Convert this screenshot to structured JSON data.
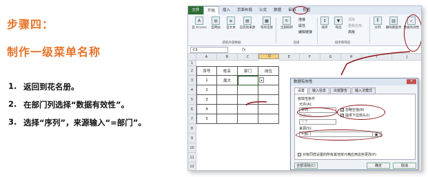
{
  "heading": {
    "line1": "步骤四：",
    "line2": "制作一级菜单名称"
  },
  "steps": [
    {
      "num": "1.",
      "text": "返回到花名册。"
    },
    {
      "num": "2.",
      "text": "在部门列选择“数据有效性”。"
    },
    {
      "num": "3.",
      "text": "选择“序列”，来源输入“=部门”。"
    }
  ],
  "excel": {
    "tabs": [
      "文件",
      "开始",
      "插入",
      "页面布局",
      "公式",
      "数据",
      "审阅",
      "视图"
    ],
    "ribbon": {
      "g1": [
        "自 Access",
        "自网站",
        "自文本",
        "自其他来源",
        "现有连接"
      ],
      "g1_label": "获取外部数据",
      "g2": [
        "全部刷新"
      ],
      "g2_small": [
        "连接",
        "属性",
        "编辑链接"
      ],
      "g2_label": "连接",
      "g3": [
        "排序",
        "筛选"
      ],
      "g3_small": [
        "清除",
        "重新应用",
        "高级"
      ],
      "g3_label": "排序和筛选",
      "g4": [
        "分列",
        "删除重复项",
        "数据有效性"
      ]
    },
    "namebox": "C3",
    "fx": "fx",
    "columns": [
      "A",
      "B",
      "C",
      "D",
      "E",
      "F",
      "G",
      "H",
      "I",
      "J"
    ],
    "rows": [
      "1",
      "2",
      "3",
      "4",
      "5",
      "6",
      "7",
      "8",
      "9",
      "10",
      "11",
      "12"
    ],
    "table": {
      "headers": [
        "序号",
        "姓名",
        "部门",
        "岗位"
      ],
      "data": [
        [
          "1",
          "周大",
          "",
          ""
        ],
        [
          "2",
          "",
          "",
          ""
        ],
        [
          "3",
          "",
          "",
          ""
        ],
        [
          "4",
          "",
          "",
          ""
        ],
        [
          "5",
          "",
          "",
          ""
        ]
      ]
    },
    "dialog": {
      "title": "数据有效性",
      "close": "✕",
      "tabs": [
        "设置",
        "输入信息",
        "出错警告",
        "输入法模式"
      ],
      "criteria": "有效性条件",
      "allow_label": "允许(A):",
      "allow_value": "序列",
      "ignore_blank": "忽略空值(B)",
      "dropdown": "提供下拉箭头(I)",
      "data_label": "数据(D):",
      "data_value": "介于",
      "source_label": "来源(S):",
      "source_value": "=部门",
      "apply_all": "对有同样设置的所有其他单元格应用这些更改(P)",
      "clear_all": "全部清除(C)",
      "ok": "确定",
      "cancel": "取消"
    }
  },
  "colors": {
    "accent": "#e8742a",
    "annotation": "#8b1010",
    "file_tab": "#2e6e35"
  }
}
